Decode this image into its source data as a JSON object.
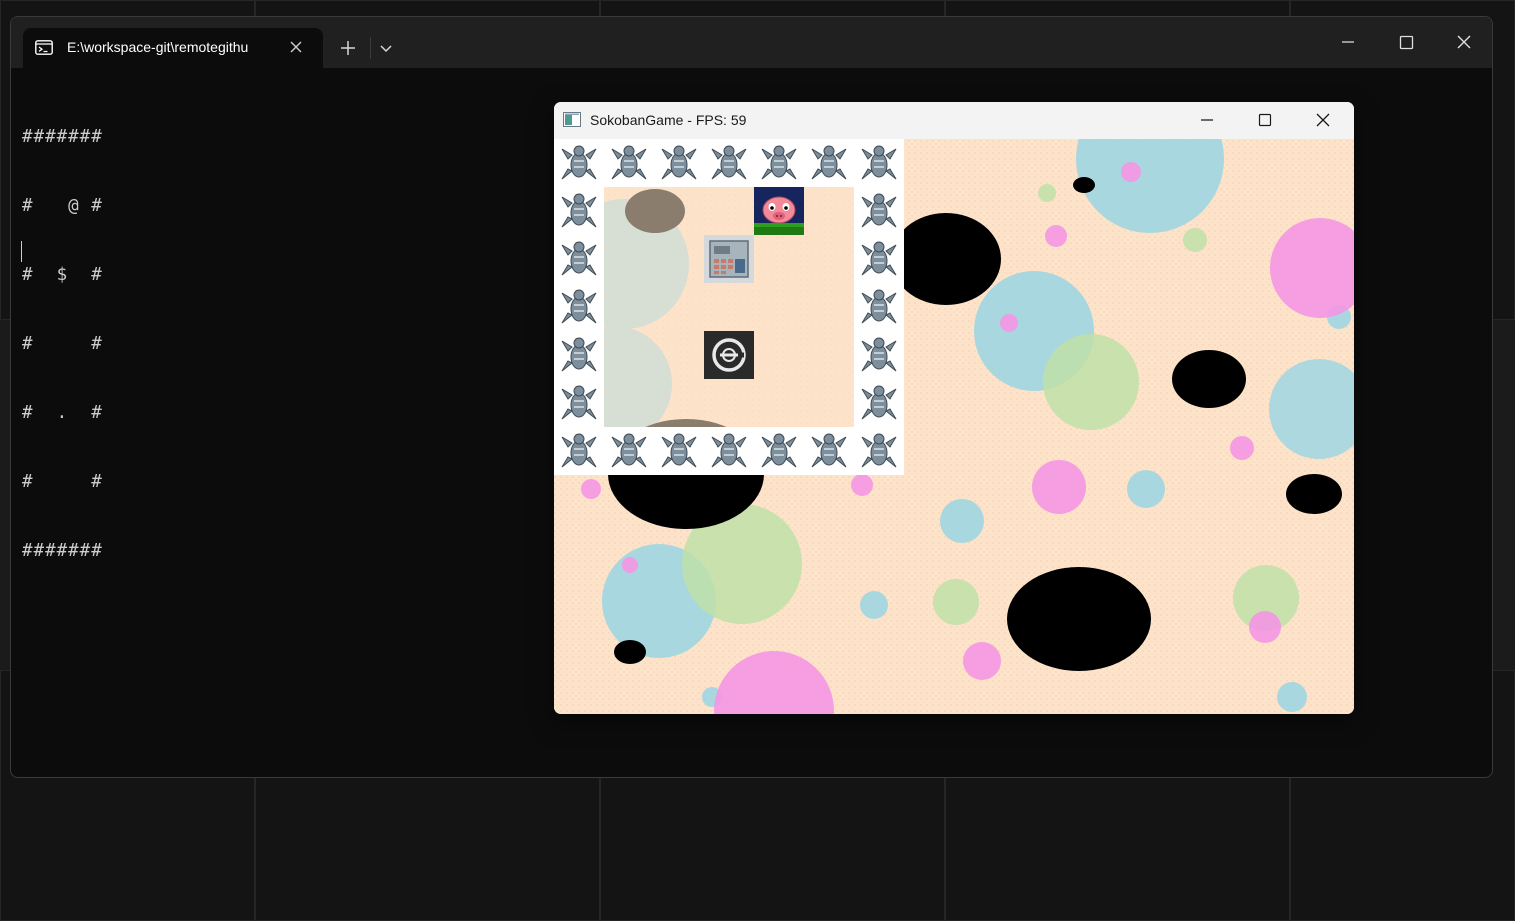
{
  "terminal": {
    "tab_title": "E:\\workspace-git\\remotegithu",
    "icon": "terminal-icon",
    "lines": [
      "#######",
      "#   @ #",
      "#  $  #",
      "#     #",
      "#  .  #",
      "#     #",
      "#######"
    ],
    "controls": [
      "minimize-icon",
      "maximize-icon",
      "close-icon"
    ]
  },
  "game": {
    "title": "SokobanGame - FPS: 59",
    "icon": "app-window-icon",
    "controls": [
      "minimize-icon",
      "maximize-icon",
      "close-icon"
    ],
    "level": {
      "rows": [
        "#######",
        "#   @ #",
        "#  $  #",
        "#     #",
        "#  .  #",
        "#     #",
        "#######"
      ],
      "legend": {
        "#": "wall",
        "@": "player",
        "$": "box",
        ".": "goal",
        " ": "floor"
      }
    },
    "colors": {
      "background": "#fde3c9",
      "bubble_blue": "#9fd6e3",
      "bubble_pink": "#f596e4",
      "bubble_green": "#bfe0a8",
      "hole": "#000000"
    }
  }
}
